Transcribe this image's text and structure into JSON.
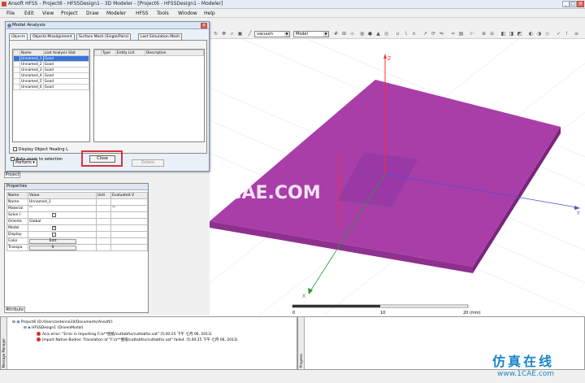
{
  "window": {
    "title": "Ansoft HFSS - Project6 - HFSSDesign1 - 3D Modeler - [Project6 - HFSSDesign1 - Modeler]",
    "min": "_",
    "max": "□",
    "close": "×"
  },
  "menu": [
    "File",
    "Edit",
    "View",
    "Project",
    "Draw",
    "Modeler",
    "HFSS",
    "Tools",
    "Window",
    "Help"
  ],
  "toolbar": {
    "select_mode": "vacuum",
    "select_model": "Model"
  },
  "dialog": {
    "title": "Model Analysis",
    "close": "x",
    "tabs": [
      "Objects",
      "Objects Misalignment",
      "Surface Mesh (Single/Pairs)",
      "Last Simulation Mesh"
    ],
    "objects_table": {
      "headers": [
        "Name",
        "Last Analysis Stat"
      ],
      "rows": [
        {
          "name": "Unnamed_1",
          "status": "Good"
        },
        {
          "name": "Unnamed_2",
          "status": "Good"
        },
        {
          "name": "Unnamed_3",
          "status": "Good"
        },
        {
          "name": "Unnamed_4",
          "status": "Good"
        },
        {
          "name": "Unnamed_5",
          "status": "Good"
        },
        {
          "name": "Unnamed_6",
          "status": "Good"
        }
      ]
    },
    "diff_headers": [
      "Type",
      "Entity List",
      "Description"
    ],
    "display_healing": "Display Object Healing L",
    "perform": "Perform",
    "delete": "Delete",
    "auto_zoom": "Auto zoom to selection",
    "close_button": "Close"
  },
  "left_tabs": {
    "project": "Project",
    "attributes": "Attribute"
  },
  "properties": {
    "title": "Properties",
    "headers": [
      "Name",
      "Value",
      "Unit",
      "Evaluated V"
    ],
    "rows": [
      {
        "name": "Name",
        "value": "Unnamed_1",
        "unit": "",
        "eval": ""
      },
      {
        "name": "Material",
        "value": "\"\"",
        "unit": "",
        "eval": "\"\""
      },
      {
        "name": "Solve I",
        "value": "",
        "unit": "",
        "eval": ""
      },
      {
        "name": "Orienta",
        "value": "Global",
        "unit": "",
        "eval": ""
      },
      {
        "name": "Model",
        "value": "",
        "unit": "",
        "eval": ""
      },
      {
        "name": "Display",
        "value": "",
        "unit": "",
        "eval": ""
      },
      {
        "name": "Color",
        "value": "Edit",
        "unit": "",
        "eval": ""
      },
      {
        "name": "Transpa",
        "value": "0",
        "unit": "",
        "eval": ""
      }
    ],
    "checks": {
      "solve": false,
      "model": true,
      "display": false
    }
  },
  "messages": {
    "side_label": "Message Manager",
    "project": "Project6 (D:/Users/antenna10/Documents/Ansoft/)",
    "design": "HFSSDesign1 (DrivenModal)",
    "lines": [
      "Acis error: \"Error in Importing F:/a**图纸/cuttobfss/cuttobfss.sat\" (5:40:25 下午  七月 06, 2013)",
      "Import Native Bodies: Translation of \"F:/a**图纸/cuttobfss/cuttobfss.sat\" failed. (5:40:25 下午  七月 06, 2013)"
    ]
  },
  "progress": {
    "side_label": "Progress"
  },
  "viewport": {
    "axis_y": "Z",
    "axis_x": "Y",
    "axis_z": "X",
    "scale": {
      "labels": [
        "0",
        "10",
        "20 (mm)"
      ]
    },
    "watermark": "1CAE.COM",
    "plate_color": "#a93ea9"
  },
  "watermark": {
    "cn": "仿真在线",
    "url": "www.1CAE.com"
  }
}
